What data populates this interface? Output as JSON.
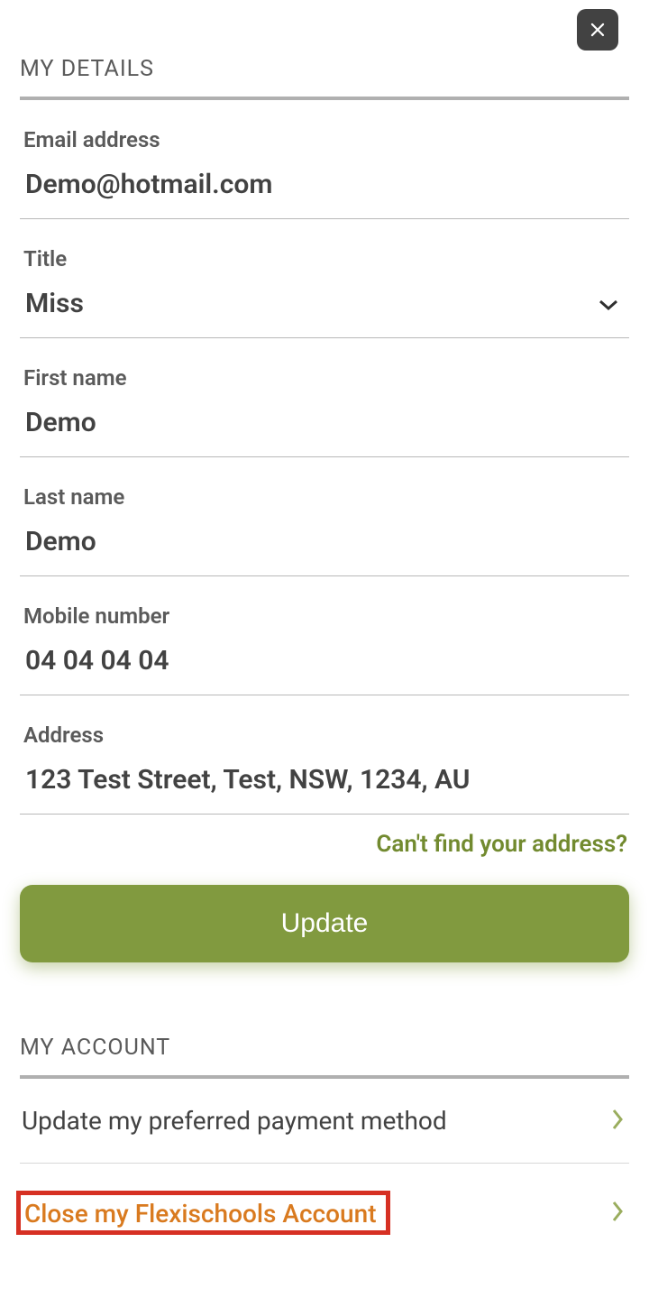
{
  "header": {
    "close_icon": "close"
  },
  "sections": {
    "details_title": "MY DETAILS",
    "account_title": "MY ACCOUNT"
  },
  "fields": {
    "email": {
      "label": "Email address",
      "value": "Demo@hotmail.com"
    },
    "title": {
      "label": "Title",
      "value": "Miss"
    },
    "first_name": {
      "label": "First name",
      "value": "Demo"
    },
    "last_name": {
      "label": "Last name",
      "value": "Demo"
    },
    "mobile": {
      "label": "Mobile number",
      "value": "04 04 04 04"
    },
    "address": {
      "label": "Address",
      "value": "123 Test Street, Test, NSW, 1234, AU"
    }
  },
  "links": {
    "address_helper": "Can't find your address?"
  },
  "buttons": {
    "update": "Update"
  },
  "account_nav": {
    "payment": "Update my preferred payment method",
    "close_account": "Close my Flexischools Account"
  }
}
